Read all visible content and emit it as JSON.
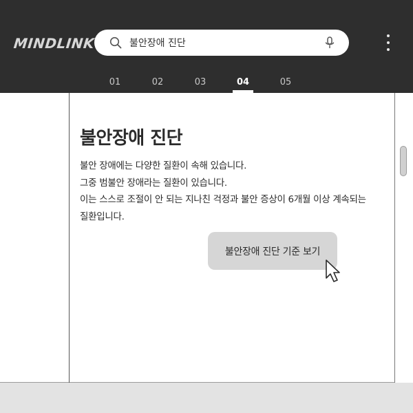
{
  "header": {
    "logo": "MINDLINK",
    "search": {
      "value": "불안장애 진단",
      "placeholder": ""
    },
    "tabs": [
      {
        "label": "01",
        "active": false
      },
      {
        "label": "02",
        "active": false
      },
      {
        "label": "03",
        "active": false
      },
      {
        "label": "04",
        "active": true
      },
      {
        "label": "05",
        "active": false
      }
    ]
  },
  "content": {
    "title": "불안장애 진단",
    "paragraph_lines": [
      "불안 장애에는 다양한 질환이 속해 있습니다.",
      "그중 범불안 장애라는 질환이 있습니다.",
      "이는 스스로 조절이 안 되는 지나친 걱정과 불안 증상이 6개월 이상 계속되는",
      "질환입니다."
    ],
    "criteria_button_label": "불안장애 진단 기준 보기"
  },
  "icons": {
    "search": "search-icon",
    "mic": "microphone-icon",
    "menu": "kebab-menu-icon",
    "cursor": "mouse-pointer-icon"
  },
  "colors": {
    "header_bg": "#2e2e2e",
    "logo": "#d7d7d7",
    "button_bg": "#d6d6d6",
    "page_bg": "#ffffff",
    "footer_bg": "#e3e3e3"
  }
}
